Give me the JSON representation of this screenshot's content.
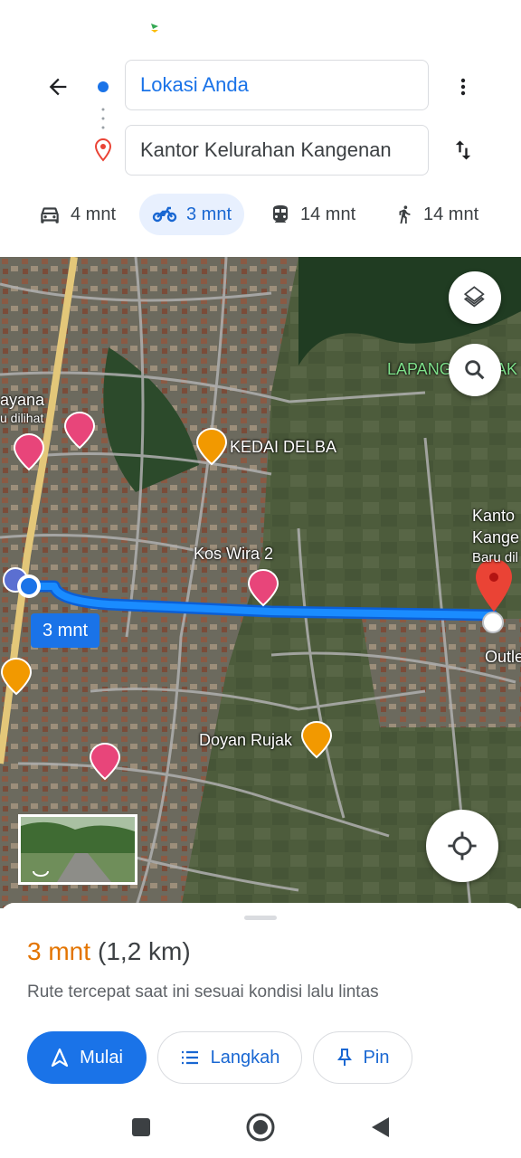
{
  "header": {
    "origin_value": "Lokasi Anda",
    "destination_value": "Kantor Kelurahan Kangenan"
  },
  "modes": [
    {
      "name": "car",
      "time": "4 mnt",
      "icon": "car-icon",
      "selected": false
    },
    {
      "name": "motorbike",
      "time": "3 mnt",
      "icon": "motorbike-icon",
      "selected": true
    },
    {
      "name": "transit",
      "time": "14 mnt",
      "icon": "train-icon",
      "selected": false
    },
    {
      "name": "walk",
      "time": "14 mnt",
      "icon": "walking-icon",
      "selected": false
    }
  ],
  "map": {
    "route_label": "3 mnt",
    "places": {
      "kedai": "KEDAI DELBA",
      "kos": "Kos Wira 2",
      "rujak": "Doyan Rujak",
      "lapangan": "LAPANG",
      "lapangan_tail": "AK",
      "left_name": "ayana",
      "left_sub": "u dilihat",
      "dest_name_1": "Kanto",
      "dest_name_2": "Kange",
      "dest_sub": "Baru dil",
      "outlet": "Outle"
    }
  },
  "sheet": {
    "eta_time": "3 mnt",
    "eta_distance": "(1,2 km)",
    "description": "Rute tercepat saat ini sesuai kondisi lalu lintas",
    "start_label": "Mulai",
    "steps_label": "Langkah",
    "pin_label": "Pin"
  },
  "colors": {
    "accent": "#1a73e8",
    "eta": "#e37400",
    "route": "#1a8cff",
    "destination_pin": "#ea4335",
    "poi_lodging": "#e8457a",
    "poi_food": "#f29900"
  }
}
